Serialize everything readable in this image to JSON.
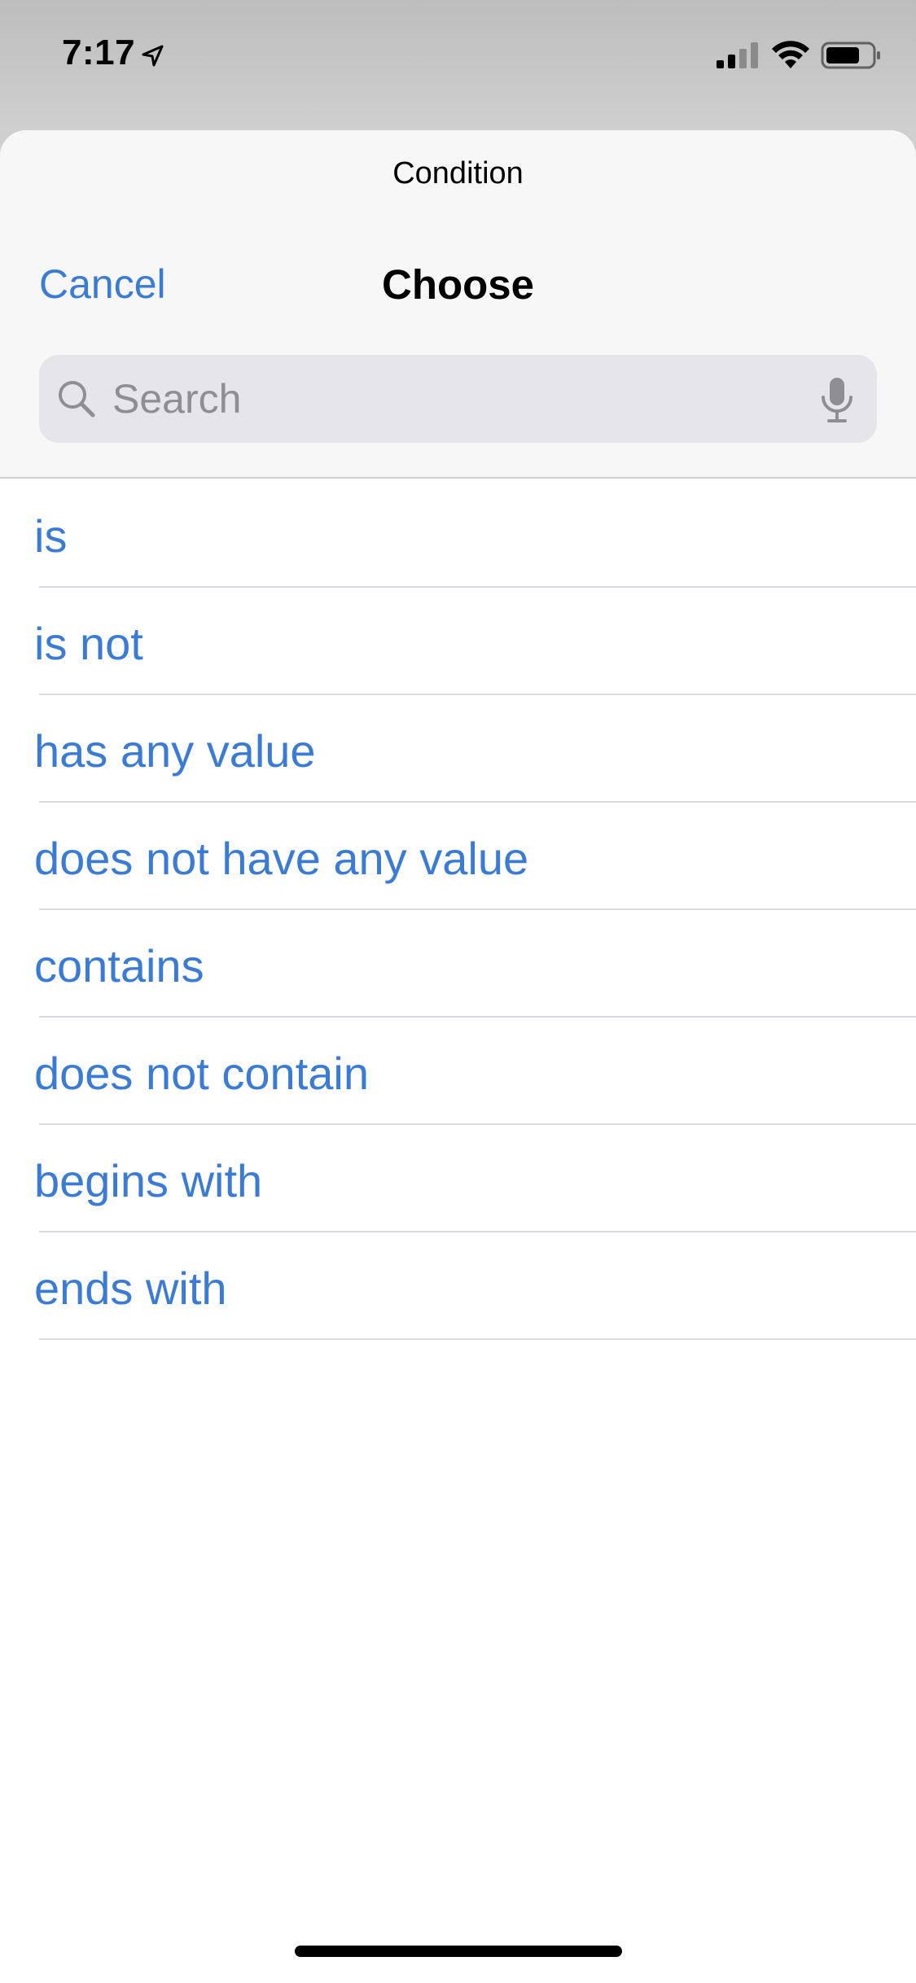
{
  "status_bar": {
    "time": "7:17",
    "icons": [
      "location-arrow-icon",
      "cellular-signal-icon",
      "wifi-icon",
      "battery-icon"
    ]
  },
  "sheet": {
    "title": "Condition",
    "nav": {
      "cancel_label": "Cancel",
      "title": "Choose"
    },
    "search": {
      "placeholder": "Search",
      "value": ""
    }
  },
  "options": [
    {
      "label": "is"
    },
    {
      "label": "is not"
    },
    {
      "label": "has any value"
    },
    {
      "label": "does not have any value"
    },
    {
      "label": "contains"
    },
    {
      "label": "does not contain"
    },
    {
      "label": "begins with"
    },
    {
      "label": "ends with"
    }
  ],
  "colors": {
    "accent": "#3a7bd5",
    "search_bg": "#e5e5ea",
    "header_bg": "#f7f7f7"
  }
}
